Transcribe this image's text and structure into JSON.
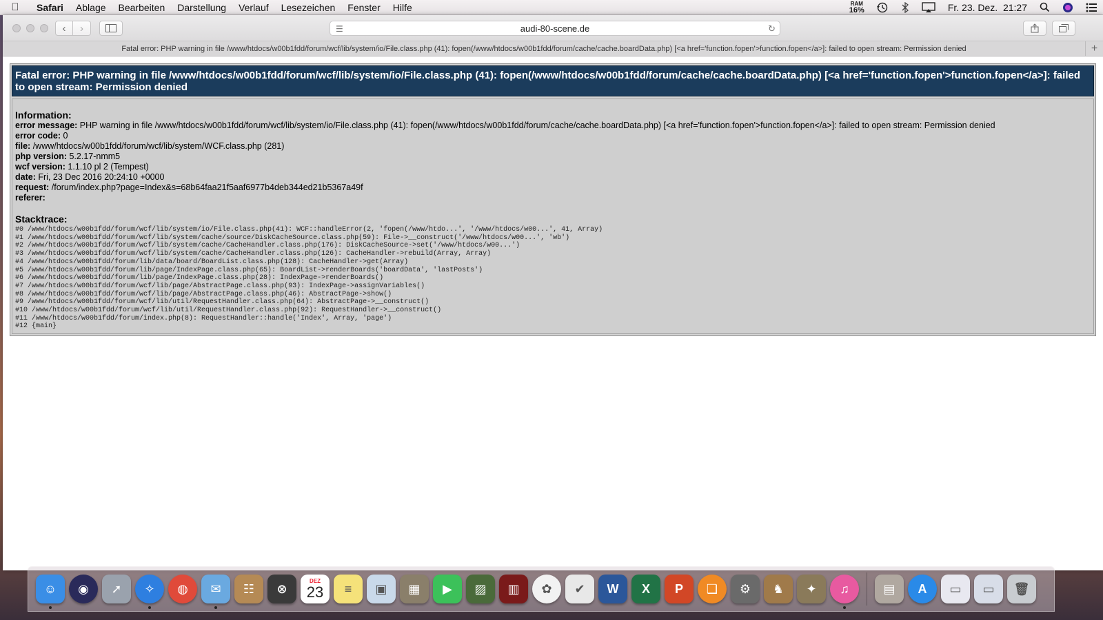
{
  "menubar": {
    "app_name": "Safari",
    "items": [
      "Ablage",
      "Bearbeiten",
      "Darstellung",
      "Verlauf",
      "Lesezeichen",
      "Fenster",
      "Hilfe"
    ],
    "ram_label": "RAM",
    "ram_value": "16%",
    "datetime": "Fr. 23. Dez.  21:27"
  },
  "browser": {
    "address": "audi-80-scene.de",
    "tab_title": "Fatal error: PHP warning in file /www/htdocs/w00b1fdd/forum/wcf/lib/system/io/File.class.php (41): fopen(/www/htdocs/w00b1fdd/forum/cache/cache.boardData.php) [<a href='function.fopen'>function.fopen</a>]: failed to open stream: Permission denied"
  },
  "error": {
    "title": "Fatal error: PHP warning in file /www/htdocs/w00b1fdd/forum/wcf/lib/system/io/File.class.php (41): fopen(/www/htdocs/w00b1fdd/forum/cache/cache.boardData.php) [<a href='function.fopen'>function.fopen</a>]: failed to open stream: Permission denied",
    "information_heading": "Information:",
    "fields": [
      {
        "label": "error message:",
        "value": "PHP warning in file /www/htdocs/w00b1fdd/forum/wcf/lib/system/io/File.class.php (41): fopen(/www/htdocs/w00b1fdd/forum/cache/cache.boardData.php) [<a href='function.fopen'>function.fopen</a>]: failed to open stream: Permission denied"
      },
      {
        "label": "error code:",
        "value": "0"
      },
      {
        "label": "file:",
        "value": "/www/htdocs/w00b1fdd/forum/wcf/lib/system/WCF.class.php (281)"
      },
      {
        "label": "php version:",
        "value": "5.2.17-nmm5"
      },
      {
        "label": "wcf version:",
        "value": "1.1.10 pl 2 (Tempest)"
      },
      {
        "label": "date:",
        "value": "Fri, 23 Dec 2016 20:24:10 +0000"
      },
      {
        "label": "request:",
        "value": "/forum/index.php?page=Index&s=68b64faa21f5aaf6977b4deb344ed21b5367a49f"
      },
      {
        "label": "referer:",
        "value": ""
      }
    ],
    "stacktrace_heading": "Stacktrace:",
    "stacktrace": [
      "#0 /www/htdocs/w00b1fdd/forum/wcf/lib/system/io/File.class.php(41): WCF::handleError(2, 'fopen(/www/htdo...', '/www/htdocs/w00...', 41, Array)",
      "#1 /www/htdocs/w00b1fdd/forum/wcf/lib/system/cache/source/DiskCacheSource.class.php(59): File->__construct('/www/htdocs/w00...', 'wb')",
      "#2 /www/htdocs/w00b1fdd/forum/wcf/lib/system/cache/CacheHandler.class.php(176): DiskCacheSource->set('/www/htdocs/w00...')",
      "#3 /www/htdocs/w00b1fdd/forum/wcf/lib/system/cache/CacheHandler.class.php(126): CacheHandler->rebuild(Array, Array)",
      "#4 /www/htdocs/w00b1fdd/forum/lib/data/board/BoardList.class.php(128): CacheHandler->get(Array)",
      "#5 /www/htdocs/w00b1fdd/forum/lib/page/IndexPage.class.php(65): BoardList->renderBoards('boardData', 'lastPosts')",
      "#6 /www/htdocs/w00b1fdd/forum/lib/page/IndexPage.class.php(28): IndexPage->renderBoards()",
      "#7 /www/htdocs/w00b1fdd/forum/wcf/lib/page/AbstractPage.class.php(93): IndexPage->assignVariables()",
      "#8 /www/htdocs/w00b1fdd/forum/wcf/lib/page/AbstractPage.class.php(46): AbstractPage->show()",
      "#9 /www/htdocs/w00b1fdd/forum/wcf/lib/util/RequestHandler.class.php(64): AbstractPage->__construct()",
      "#10 /www/htdocs/w00b1fdd/forum/wcf/lib/util/RequestHandler.class.php(92): RequestHandler->__construct()",
      "#11 /www/htdocs/w00b1fdd/forum/index.php(8): RequestHandler::handle('Index', Array, 'page')",
      "#12 {main}"
    ]
  },
  "dock": {
    "calendar_month": "DEZ",
    "calendar_day": "23",
    "apps": [
      {
        "icon": "finder-icon",
        "color": "#3a8ee6",
        "glyph": "☺",
        "running": true
      },
      {
        "icon": "siri-icon",
        "color": "#2a2a5a",
        "glyph": "◉",
        "running": false
      },
      {
        "icon": "launchpad-icon",
        "color": "#9aa2ad",
        "glyph": "➚",
        "running": false
      },
      {
        "icon": "safari-icon",
        "color": "#2e7fe0",
        "glyph": "✧",
        "running": true
      },
      {
        "icon": "chrome-icon",
        "color": "#e04a3a",
        "glyph": "◍",
        "running": false
      },
      {
        "icon": "mail-icon",
        "color": "#6aa9e0",
        "glyph": "✉",
        "running": true
      },
      {
        "icon": "contacts-icon",
        "color": "#b58a55",
        "glyph": "☷",
        "running": false
      },
      {
        "icon": "utility-icon",
        "color": "#3a3a3a",
        "glyph": "⊗",
        "running": false
      },
      {
        "icon": "calendar-icon",
        "color": "#ffffff",
        "glyph": "",
        "running": false
      },
      {
        "icon": "notes-icon",
        "color": "#f5e27a",
        "glyph": "≡",
        "running": false
      },
      {
        "icon": "preview-icon",
        "color": "#c9d9ea",
        "glyph": "▣",
        "running": false
      },
      {
        "icon": "calculator-icon",
        "color": "#8a7f6a",
        "glyph": "▦",
        "running": false
      },
      {
        "icon": "facetime-icon",
        "color": "#3cc15a",
        "glyph": "▶",
        "running": false
      },
      {
        "icon": "photo-booth-icon",
        "color": "#4a6a3a",
        "glyph": "▨",
        "running": false
      },
      {
        "icon": "photo-viewer-icon",
        "color": "#7a1a1a",
        "glyph": "▥",
        "running": false
      },
      {
        "icon": "photos-icon",
        "color": "#f2f2f2",
        "glyph": "✿",
        "running": false
      },
      {
        "icon": "tasks-icon",
        "color": "#e8e8e8",
        "glyph": "✔",
        "running": false
      },
      {
        "icon": "word-icon",
        "color": "#2b579a",
        "glyph": "W",
        "running": false
      },
      {
        "icon": "excel-icon",
        "color": "#217346",
        "glyph": "X",
        "running": false
      },
      {
        "icon": "powerpoint-icon",
        "color": "#d24726",
        "glyph": "P",
        "running": false
      },
      {
        "icon": "ibooks-icon",
        "color": "#f08a24",
        "glyph": "❑",
        "running": false
      },
      {
        "icon": "system-preferences-icon",
        "color": "#6a6a6a",
        "glyph": "⚙",
        "running": false
      },
      {
        "icon": "chess-icon",
        "color": "#a07a4a",
        "glyph": "♞",
        "running": false
      },
      {
        "icon": "gimp-icon",
        "color": "#8a7a5a",
        "glyph": "✦",
        "running": false
      },
      {
        "icon": "itunes-icon",
        "color": "#e85aa0",
        "glyph": "♫",
        "running": true
      },
      {
        "icon": "stack-pictures-icon",
        "color": "#b0a8a0",
        "glyph": "▤",
        "running": false
      },
      {
        "icon": "app-store-icon",
        "color": "#2a8ae8",
        "glyph": "A",
        "running": false
      },
      {
        "icon": "documents-stack-icon",
        "color": "#e8e8f0",
        "glyph": "▭",
        "running": false
      },
      {
        "icon": "downloads-stack-icon",
        "color": "#d8dde8",
        "glyph": "▭",
        "running": false
      },
      {
        "icon": "trash-icon",
        "color": "#c8ccd0",
        "glyph": "🗑",
        "running": false
      }
    ]
  }
}
